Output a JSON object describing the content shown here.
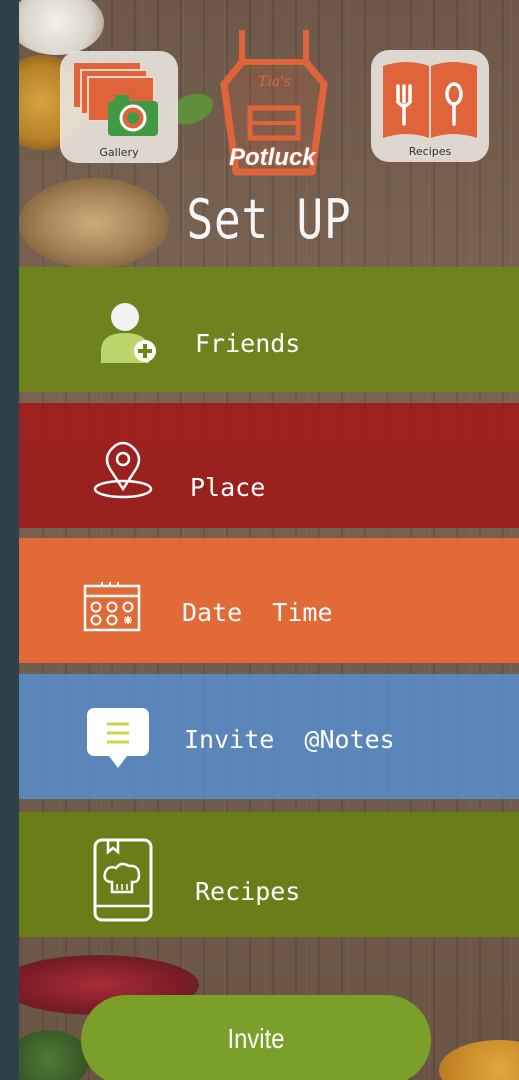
{
  "header": {
    "gallery": {
      "label": "Gallery",
      "icon": "gallery-icon"
    },
    "recipes": {
      "label": "Recipes",
      "icon": "recipe-book-icon"
    },
    "logo": {
      "script": "Tia's",
      "word": "Potluck",
      "icon": "apron-logo"
    },
    "title": "Set UP"
  },
  "menu": [
    {
      "label": "Friends",
      "icon": "add-friend-icon",
      "color": "#6c8618"
    },
    {
      "label": "Place",
      "icon": "location-pin-icon",
      "color": "#a01818"
    },
    {
      "label": "Date  Time",
      "icon": "calendar-icon",
      "color": "#e46a37"
    },
    {
      "label": "Invite  @Notes",
      "icon": "note-icon",
      "color": "#578cca"
    },
    {
      "label": "Recipes",
      "icon": "recipe-phone-icon",
      "color": "#678214"
    }
  ],
  "footer": {
    "invite_label": "Invite",
    "color": "#7aa02a"
  },
  "colors": {
    "accent_orange": "#e0643a",
    "rail": "#2e4049"
  }
}
